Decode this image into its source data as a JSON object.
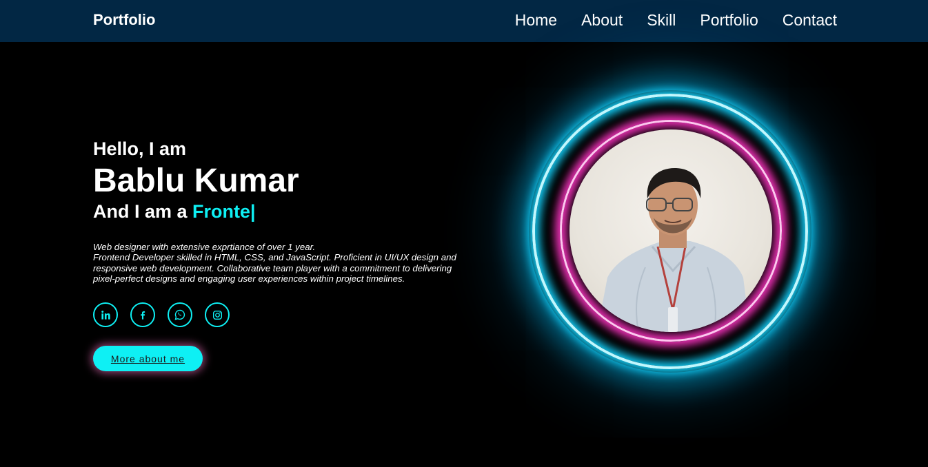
{
  "header": {
    "logo": "Portfolio",
    "nav": [
      "Home",
      "About",
      "Skill",
      "Portfolio",
      "Contact"
    ]
  },
  "hero": {
    "greeting": "Hello, I am",
    "name": "Bablu Kumar",
    "role_prefix": "And I am a ",
    "role_typed": "Fronte|",
    "description_line1": "Web designer with extensive exprtiance of over 1 year.",
    "description_line2": "Frontend Developer skilled in HTML, CSS, and JavaScript. Proficient in UI/UX design and responsive web development. Collaborative team player with a commitment to delivering pixel-perfect designs and engaging user experiences within project timelines.",
    "more_button": "More about me"
  },
  "social": {
    "icons": [
      "linkedin-icon",
      "facebook-icon",
      "whatsapp-icon",
      "instagram-icon"
    ]
  },
  "colors": {
    "navbar": "#022744",
    "accent": "#0ef0f4",
    "ring_cyan": "#13d4ff",
    "ring_pink": "#e62fb0"
  }
}
